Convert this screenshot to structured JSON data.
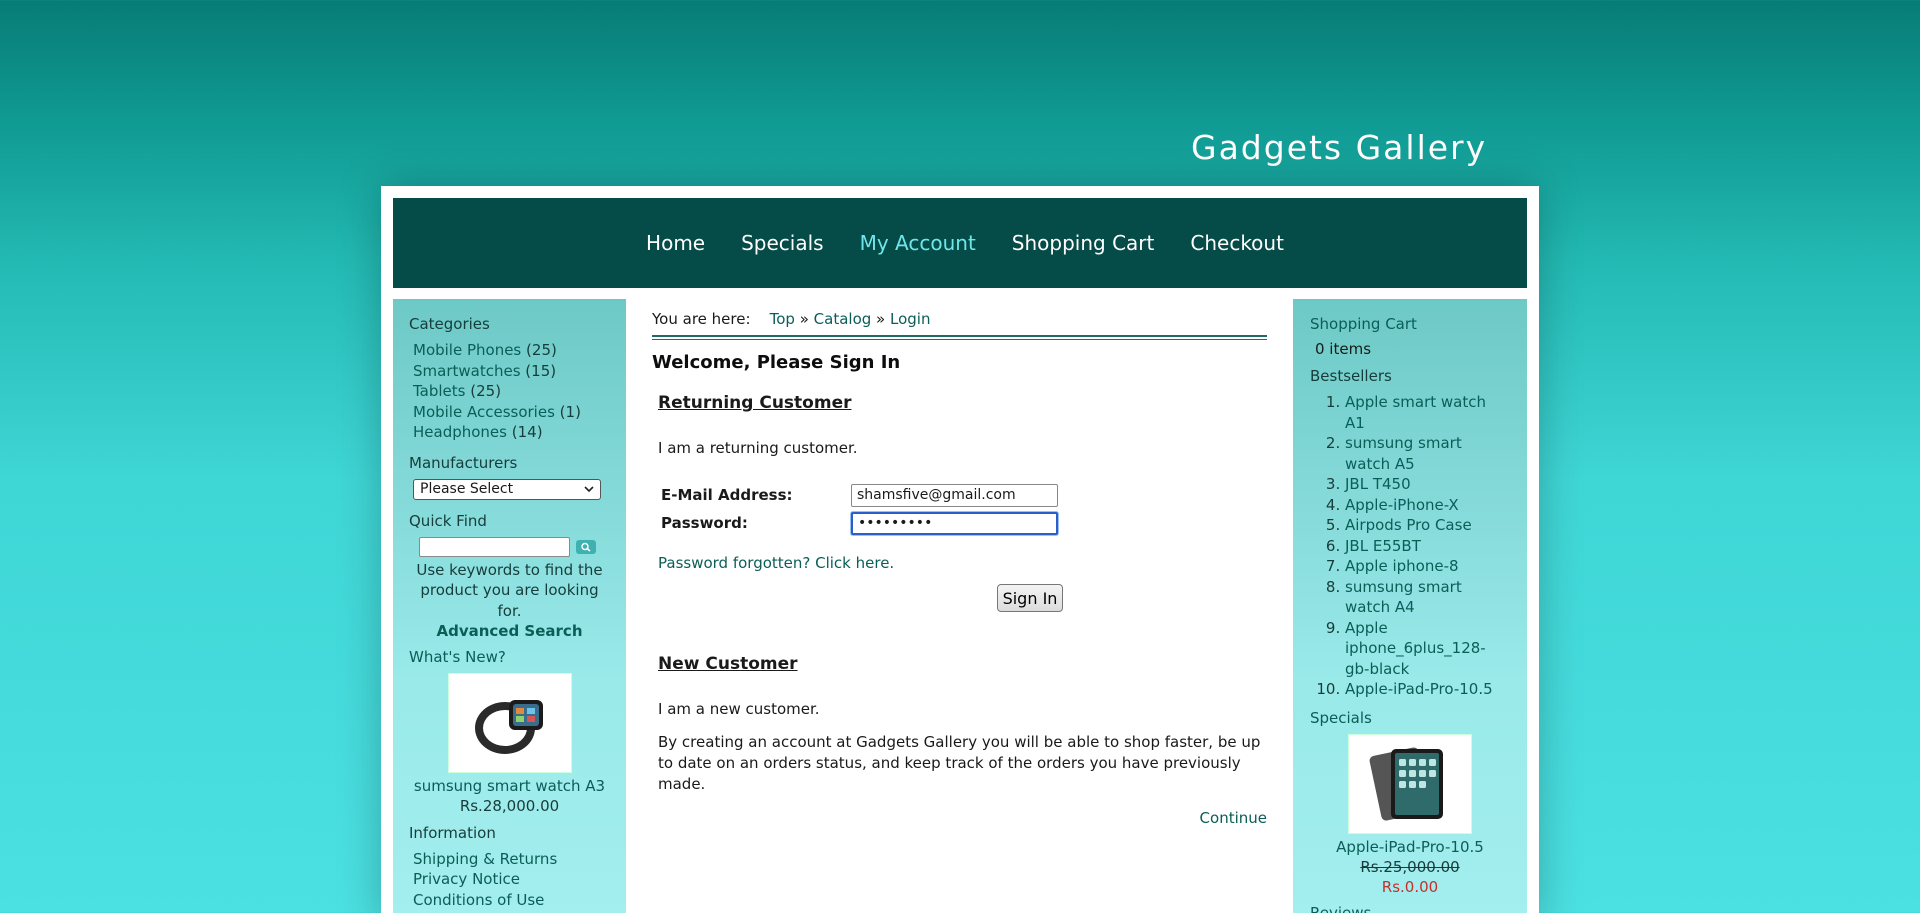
{
  "site": {
    "title": "Gadgets Gallery"
  },
  "nav": {
    "items": [
      {
        "label": "Home"
      },
      {
        "label": "Specials"
      },
      {
        "label": "My Account"
      },
      {
        "label": "Shopping Cart"
      },
      {
        "label": "Checkout"
      }
    ],
    "active": "My Account"
  },
  "left": {
    "categories_heading": "Categories",
    "categories": [
      {
        "name": "Mobile Phones",
        "count": "(25)"
      },
      {
        "name": "Smartwatches",
        "count": "(15)"
      },
      {
        "name": "Tablets",
        "count": "(25)"
      },
      {
        "name": "Mobile Accessories",
        "count": "(1)"
      },
      {
        "name": "Headphones",
        "count": "(14)"
      }
    ],
    "manufacturers_heading": "Manufacturers",
    "manufacturers_selected": "Please Select",
    "quickfind_heading": "Quick Find",
    "quickfind_value": "",
    "quickfind_help": "Use keywords to find the product you are looking for.",
    "advanced_search": "Advanced Search",
    "whats_new_heading": "What's New?",
    "whats_new_product": "sumsung smart watch A3",
    "whats_new_price": "Rs.28,000.00",
    "information_heading": "Information",
    "information_links": [
      "Shipping & Returns",
      "Privacy Notice",
      "Conditions of Use"
    ]
  },
  "breadcrumb": {
    "prefix": "You are here:",
    "items": [
      "Top",
      "Catalog",
      "Login"
    ],
    "separator": "»"
  },
  "main": {
    "title": "Welcome, Please Sign In",
    "returning_heading": "Returning Customer",
    "returning_text": "I am a returning customer.",
    "email_label": "E-Mail Address:",
    "email_value": "shamsfive@gmail.com",
    "password_label": "Password:",
    "password_value": "•••••••••",
    "forgot_link": "Password forgotten? Click here.",
    "signin_button": "Sign In",
    "new_heading": "New Customer",
    "new_text": "I am a new customer.",
    "new_description": "By creating an account at Gadgets Gallery you will be able to shop faster, be up to date on an orders status, and keep track of the orders you have previously made.",
    "continue_link": "Continue"
  },
  "right": {
    "cart_heading": "Shopping Cart",
    "cart_items": "0 items",
    "bestsellers_heading": "Bestsellers",
    "bestsellers": [
      "Apple smart watch A1",
      "sumsung smart watch A5",
      "JBL T450",
      "Apple-iPhone-X",
      "Airpods Pro Case",
      "JBL E55BT",
      "Apple iphone-8",
      "sumsung smart watch A4",
      "Apple iphone_6plus_128-gb-black",
      "Apple-iPad-Pro-10.5"
    ],
    "specials_heading": "Specials",
    "specials_product": "Apple-iPad-Pro-10.5",
    "specials_old_price": "Rs.25,000.00",
    "specials_new_price": "Rs.0.00",
    "reviews_heading": "Reviews"
  },
  "colors": {
    "nav_bg": "#054b48",
    "nav_active": "#6fe7ea",
    "link": "#0b5e57",
    "special_price": "#c4312d"
  },
  "icons": {
    "quickfind": "search-icon",
    "select": "chevron-down-icon"
  }
}
